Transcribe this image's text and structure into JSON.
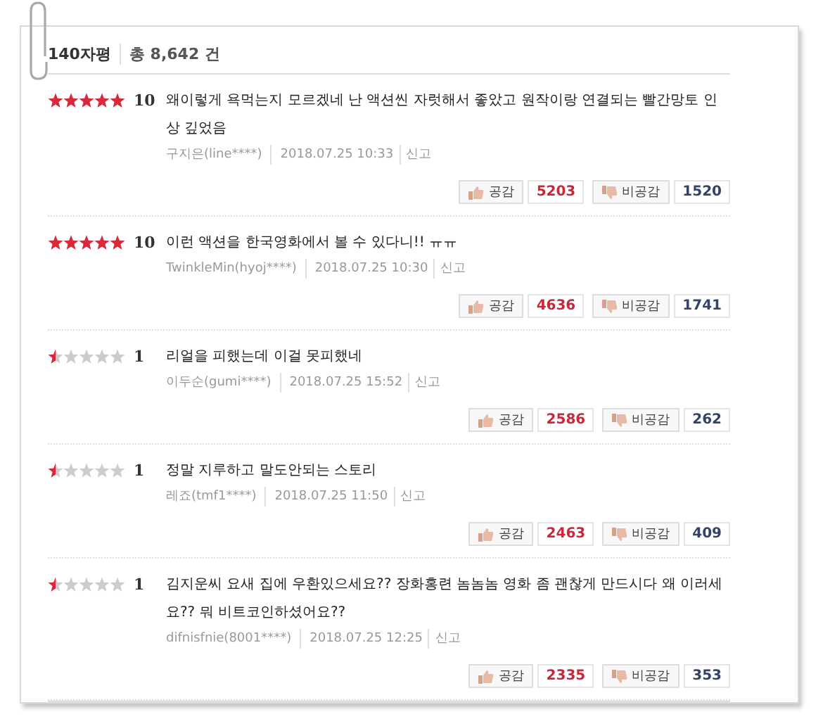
{
  "header": {
    "title": "140자평",
    "total": "총 8,642 건"
  },
  "reviews": [
    {
      "stars": 5,
      "score": "10",
      "text": "왜이렇게 욕먹는지 모르겠네 난 액션씬 자럿해서 좋았고 원작이랑 연결되는 빨간망토 인상 깊었음",
      "author": "구지은(line****)",
      "date": "2018.07.25 10:33",
      "report": "신고",
      "like_label": "공감",
      "likes": "5203",
      "dislike_label": "비공감",
      "dislikes": "1520"
    },
    {
      "stars": 5,
      "score": "10",
      "text": "이런 액션을 한국영화에서 볼 수 있다니!! ㅠㅠ",
      "author": "TwinkleMin(hyoj****)",
      "date": "2018.07.25 10:30",
      "report": "신고",
      "like_label": "공감",
      "likes": "4636",
      "dislike_label": "비공감",
      "dislikes": "1741"
    },
    {
      "stars": 0.5,
      "score": "1",
      "text": "리얼을 피했는데 이걸 못피했네",
      "author": "이두순(gumi****)",
      "date": "2018.07.25 15:52",
      "report": "신고",
      "like_label": "공감",
      "likes": "2586",
      "dislike_label": "비공감",
      "dislikes": "262"
    },
    {
      "stars": 0.5,
      "score": "1",
      "text": "정말 지루하고 말도안되는 스토리",
      "author": "레죠(tmf1****)",
      "date": "2018.07.25 11:50",
      "report": "신고",
      "like_label": "공감",
      "likes": "2463",
      "dislike_label": "비공감",
      "dislikes": "409"
    },
    {
      "stars": 0.5,
      "score": "1",
      "text": "김지운씨 요새 집에 우환있으세요?? 장화홍련 놈놈놈 영화 좀 괜찮게 만드시다 왜 이러세요?? 뭐 비트코인하셨어요??",
      "author": "difnisfnie(8001****)",
      "date": "2018.07.25 12:25",
      "report": "신고",
      "like_label": "공감",
      "likes": "2335",
      "dislike_label": "비공감",
      "dislikes": "353"
    }
  ]
}
